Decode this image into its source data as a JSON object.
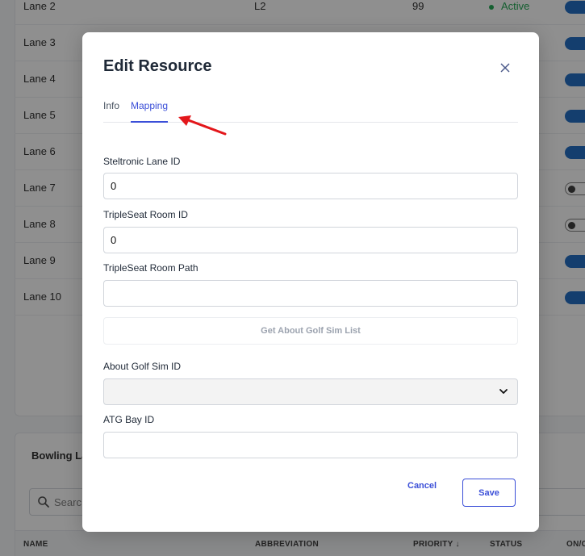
{
  "background": {
    "rows": [
      {
        "name": "Lane 2",
        "abbreviation": "L2",
        "priority": "99",
        "status": "Active",
        "toggle": "on"
      },
      {
        "name": "Lane 3",
        "toggle": "on"
      },
      {
        "name": "Lane 4",
        "toggle": "on"
      },
      {
        "name": "Lane 5",
        "toggle": "on"
      },
      {
        "name": "Lane 6",
        "toggle": "on"
      },
      {
        "name": "Lane 7",
        "toggle": "off"
      },
      {
        "name": "Lane 8",
        "toggle": "off"
      },
      {
        "name": "Lane 9",
        "toggle": "on"
      },
      {
        "name": "Lane 10",
        "toggle": "on"
      }
    ],
    "section_title": "Bowling La",
    "search_placeholder": "Searc",
    "columns": {
      "name": "NAME",
      "abbreviation": "ABBREVIATION",
      "priority": "PRIORITY ↓",
      "status": "STATUS",
      "onoff": "ON/C"
    }
  },
  "modal": {
    "title": "Edit Resource",
    "close_icon": "close-icon",
    "tabs": [
      {
        "label": "Info",
        "active": false
      },
      {
        "label": "Mapping",
        "active": true
      }
    ],
    "fields": {
      "steltronic_lane_id": {
        "label": "Steltronic Lane ID",
        "value": "0"
      },
      "tripleseat_room_id": {
        "label": "TripleSeat Room ID",
        "value": "0"
      },
      "tripleseat_room_path": {
        "label": "TripleSeat Room Path",
        "value": ""
      },
      "about_golf_sim_id": {
        "label": "About Golf Sim ID",
        "value": ""
      },
      "atg_bay_id": {
        "label": "ATG Bay ID",
        "value": ""
      }
    },
    "get_list_button": "Get About Golf Sim List",
    "cancel_label": "Cancel",
    "save_label": "Save"
  },
  "colors": {
    "accent": "#3b4fd8",
    "toggle_on": "#1565c0",
    "status_active": "#16a34a",
    "annotation_arrow": "#e3171b"
  }
}
